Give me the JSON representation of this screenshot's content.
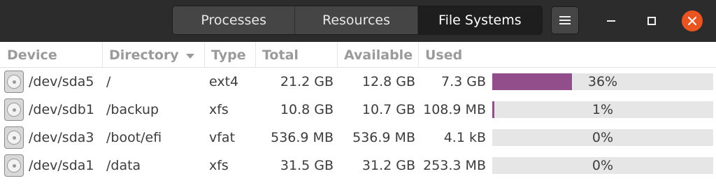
{
  "tabs": [
    {
      "label": "Processes",
      "active": false
    },
    {
      "label": "Resources",
      "active": false
    },
    {
      "label": "File Systems",
      "active": true
    }
  ],
  "window_controls": {
    "menu_icon": "hamburger-icon",
    "minimize_icon": "minimize-icon",
    "maximize_icon": "maximize-icon",
    "close_icon": "close-icon"
  },
  "columns": {
    "device": "Device",
    "directory": "Directory",
    "type": "Type",
    "total": "Total",
    "available": "Available",
    "used": "Used"
  },
  "filesystems": [
    {
      "device": "/dev/sda5",
      "directory": "/",
      "type": "ext4",
      "total": "21.2 GB",
      "available": "12.8 GB",
      "used": "7.3 GB",
      "used_percent": "36%",
      "used_fraction": 0.36
    },
    {
      "device": "/dev/sdb1",
      "directory": "/backup",
      "type": "xfs",
      "total": "10.8 GB",
      "available": "10.7 GB",
      "used": "108.9 MB",
      "used_percent": "1%",
      "used_fraction": 0.01
    },
    {
      "device": "/dev/sda3",
      "directory": "/boot/efi",
      "type": "vfat",
      "total": "536.9 MB",
      "available": "536.9 MB",
      "used": "4.1 kB",
      "used_percent": "0%",
      "used_fraction": 0.0
    },
    {
      "device": "/dev/sda1",
      "directory": "/data",
      "type": "xfs",
      "total": "31.5 GB",
      "available": "31.2 GB",
      "used": "253.3 MB",
      "used_percent": "0%",
      "used_fraction": 0.0
    }
  ],
  "colors": {
    "usage_bar": "#924d8b",
    "close_button": "#e95420"
  }
}
